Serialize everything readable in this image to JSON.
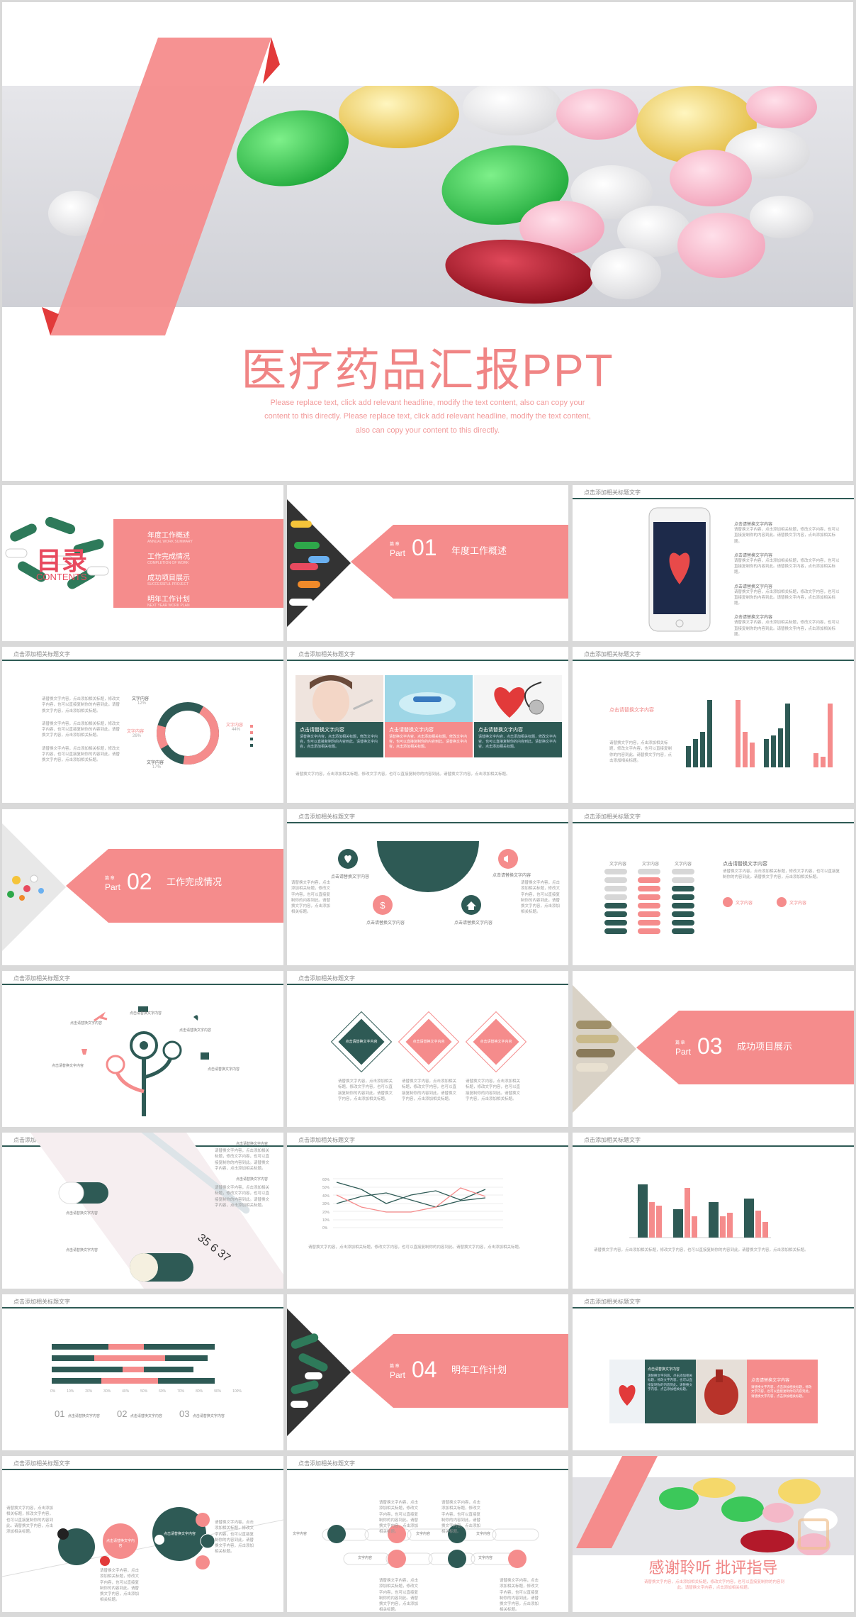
{
  "cover": {
    "title": "医疗药品汇报PPT",
    "subtitle_l1": "Please replace text, click add relevant headline, modify the text content, also can copy your",
    "subtitle_l2": "content to this directly. Please replace text, click add relevant headline, modify the text content,",
    "subtitle_l3": "also can copy your content to this directly."
  },
  "common": {
    "slide_header": "点击添加相关标题文字",
    "part_word": "Part",
    "part_top": "篇 章",
    "text_content": "文字内容",
    "title_content": "点击请替换文字内容",
    "lorem": "请替换文字内容，点击添加相关标题，修改文字内容，也可以直接复制你的内容到此。请替换文字内容，点击添加相关标题。"
  },
  "toc": {
    "title_cn": "目录",
    "title_en": "CONTENTS",
    "items": [
      {
        "label": "年度工作概述",
        "sub": "ANNUAL WORK SUMMARY"
      },
      {
        "label": "工作完成情况",
        "sub": "COMPLETION OF WORK"
      },
      {
        "label": "成功项目展示",
        "sub": "SUCCESSFUL PROJECT"
      },
      {
        "label": "明年工作计划",
        "sub": "NEXT YEAR WORK PLAN"
      }
    ]
  },
  "sections": [
    {
      "num": "01",
      "title": "年度工作概述"
    },
    {
      "num": "02",
      "title": "工作完成情况"
    },
    {
      "num": "03",
      "title": "成功项目展示"
    },
    {
      "num": "04",
      "title": "明年工作计划"
    }
  ],
  "donut": {
    "labels": [
      {
        "text": "文字内容",
        "pct": "12%"
      },
      {
        "text": "文字内容",
        "pct": "44%"
      },
      {
        "text": "文字内容",
        "pct": "26%"
      },
      {
        "text": "文字内容",
        "pct": "17%"
      }
    ]
  },
  "closing": {
    "text": "感谢聆听 批评指导"
  },
  "line_chart": {
    "y_ticks": [
      "60%",
      "50%",
      "40%",
      "30%",
      "20%",
      "10%",
      "0%"
    ]
  },
  "hbar_chart": {
    "x_ticks": [
      "0%",
      "10%",
      "20%",
      "30%",
      "40%",
      "50%",
      "60%",
      "70%",
      "80%",
      "90%",
      "100%"
    ],
    "labels": [
      "01",
      "02",
      "03"
    ]
  },
  "colors": {
    "pink": "#f58c8c",
    "teal": "#2e5a55"
  }
}
